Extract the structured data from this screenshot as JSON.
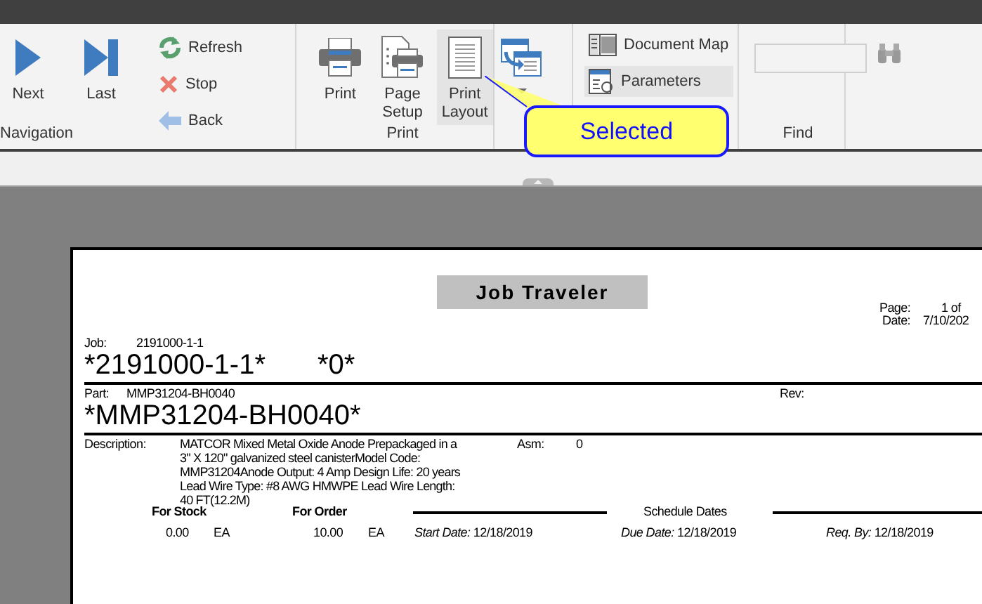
{
  "ribbon": {
    "groups": [
      {
        "label": "Navigation",
        "buttons": [
          {
            "label": "Next",
            "kind": "large",
            "selected": false
          },
          {
            "label": "Last",
            "kind": "large",
            "selected": false
          },
          {
            "label": "Refresh",
            "kind": "small",
            "selected": false
          },
          {
            "label": "Stop",
            "kind": "small",
            "selected": false
          },
          {
            "label": "Back",
            "kind": "small",
            "selected": false
          }
        ]
      },
      {
        "label": "Print",
        "buttons": [
          {
            "label": "Print",
            "kind": "large",
            "selected": false
          },
          {
            "label": "Page Setup",
            "kind": "large",
            "selected": false
          },
          {
            "label": "Print Layout",
            "kind": "large",
            "selected": true
          }
        ]
      },
      {
        "buttons": [
          {
            "kind": "dropdown",
            "selected": false
          }
        ]
      },
      {
        "buttons": [
          {
            "label": "Document Map",
            "kind": "small",
            "selected": false
          },
          {
            "label": "Parameters",
            "kind": "small",
            "selected": true
          }
        ]
      },
      {
        "label": "Find",
        "buttons": [
          {
            "kind": "search"
          }
        ]
      }
    ]
  },
  "callout": {
    "text": "Selected"
  },
  "report": {
    "title": "Job Traveler",
    "page_label": "Page:",
    "page_value": "1 of",
    "date_label": "Date:",
    "date_value": "7/10/202",
    "job_label": "Job:",
    "job_value": "2191000-1-1",
    "job_barcode": "*2191000-1-1*",
    "asm_barcode": "*0*",
    "part_label": "Part:",
    "part_value": "MMP31204-BH0040",
    "rev_label": "Rev:",
    "part_barcode": "*MMP31204-BH0040*",
    "description_label": "Description:",
    "description": "MATCOR Mixed Metal Oxide Anode Prepackaged in a 3\" X 120\" galvanized steel canisterModel Code: MMP31204Anode Output: 4 Amp Design Life: 20 years  Lead Wire Type: #8 AWG HMWPE Lead Wire Length: 40 FT(12.2M)",
    "asm_label": "Asm:",
    "asm_value": "0",
    "for_stock_label": "For Stock",
    "for_order_label": "For Order",
    "schedule_label": "Schedule Dates",
    "stock_qty": "0.00",
    "stock_uom": "EA",
    "order_qty": "10.00",
    "order_uom": "EA",
    "dates": [
      {
        "label": "Start Date:",
        "value": "12/18/2019"
      },
      {
        "label": "Due Date:",
        "value": "12/18/2019"
      },
      {
        "label": "Req. By:",
        "value": "12/18/2019"
      }
    ]
  }
}
